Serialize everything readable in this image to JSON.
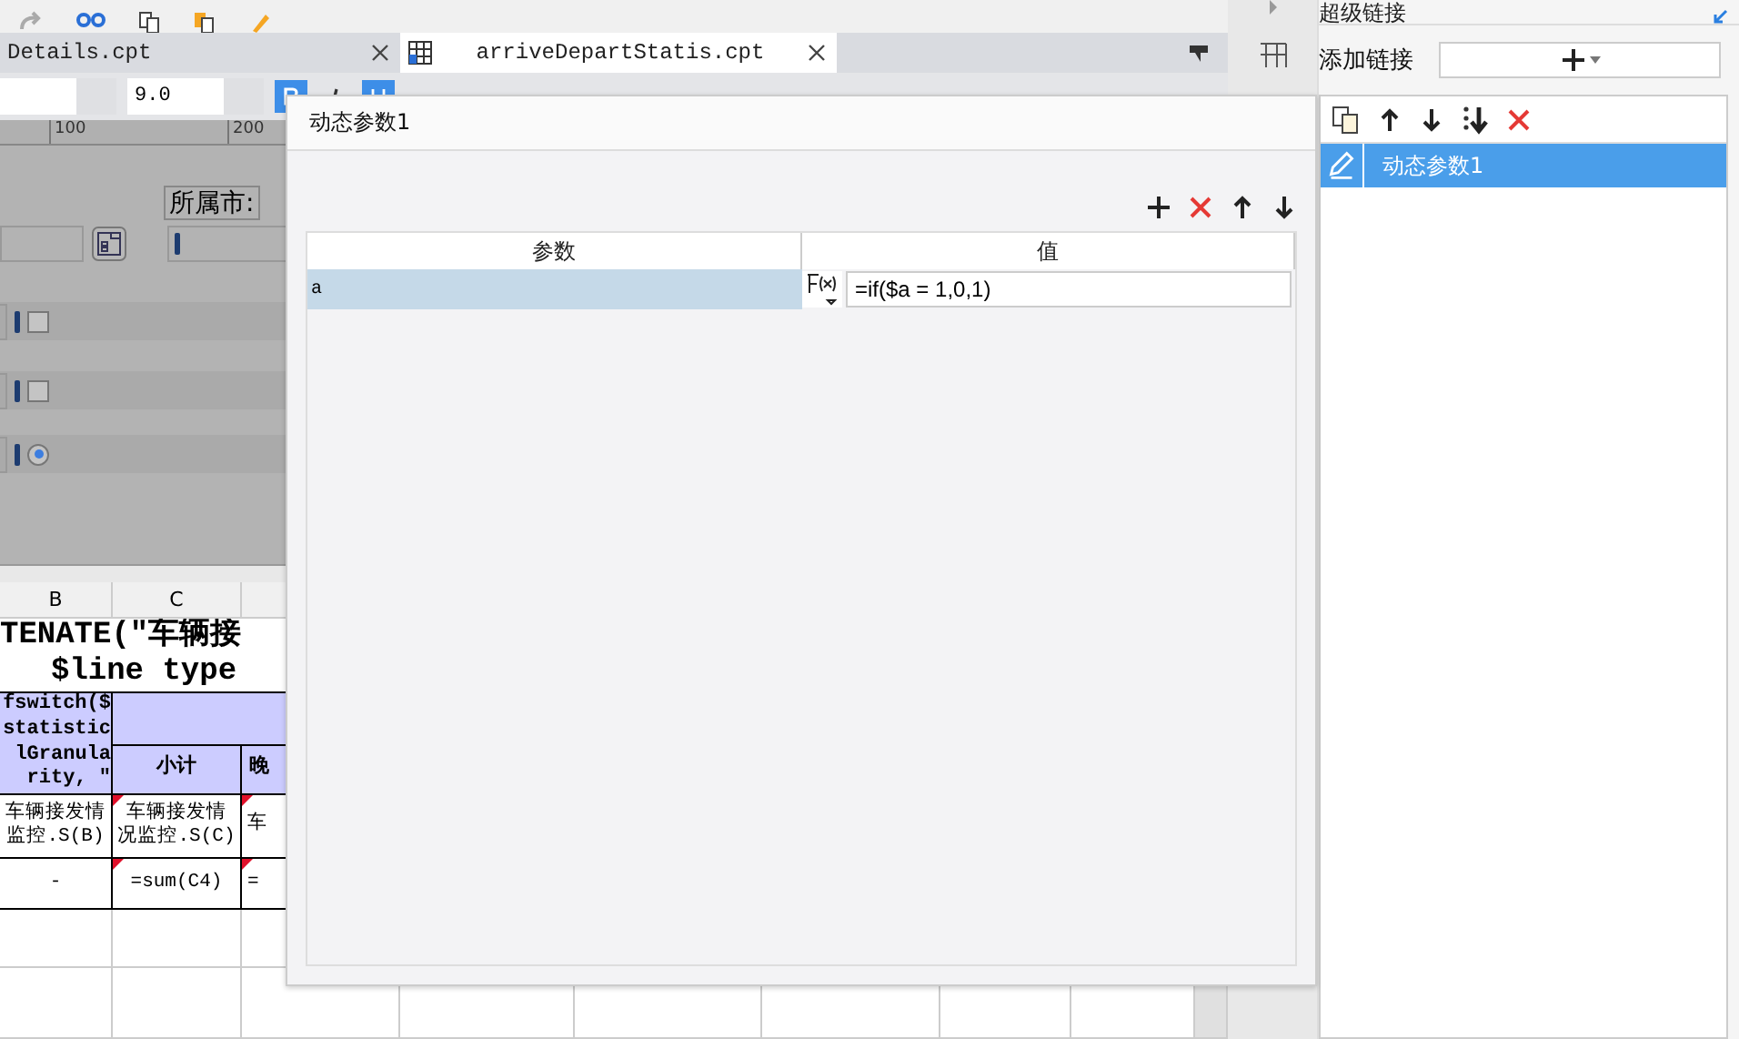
{
  "tabs": [
    {
      "label": "Details.cpt",
      "selected": false
    },
    {
      "label": "arriveDepartStatis.cpt",
      "selected": true
    }
  ],
  "format_toolbar": {
    "font_size": "9.0",
    "bold": true,
    "italic": false,
    "underline": true
  },
  "ruler": {
    "marks": [
      "100",
      "200"
    ]
  },
  "design": {
    "label": "所属市:",
    "rows": [
      {
        "kind": "checkbox",
        "checked": false
      },
      {
        "kind": "checkbox",
        "checked": false
      },
      {
        "kind": "radio",
        "checked": true
      }
    ]
  },
  "sheet": {
    "columns": [
      "B",
      "C"
    ],
    "title_lines": [
      "TENATE(\"车辆接",
      "$line type"
    ],
    "group_header": {
      "lines": [
        "fswitch($",
        "statistic",
        "lGranula",
        "rity, \""
      ]
    },
    "subheaders": [
      {
        "text": "小计"
      },
      {
        "text": "晚"
      }
    ],
    "data_rows": [
      {
        "cells": [
          {
            "lines": [
              "车辆接发情",
              "监控.S(B)"
            ],
            "marked": false
          },
          {
            "lines": [
              "车辆接发情",
              "况监控.S(C)"
            ],
            "marked": true
          },
          {
            "lines": [
              "车"
            ],
            "marked": true
          }
        ]
      },
      {
        "cells": [
          {
            "lines": [
              "-"
            ],
            "marked": false
          },
          {
            "lines": [
              "=sum(C4)"
            ],
            "marked": true
          },
          {
            "lines": [
              "="
            ],
            "marked": true
          }
        ]
      }
    ]
  },
  "dialog": {
    "title": "动态参数1",
    "columns": [
      "参数",
      "值"
    ],
    "rows": [
      {
        "name": "a",
        "value": "=if($a = 1,0,1)",
        "selected": true
      }
    ]
  },
  "side_panel": {
    "title": "超级链接",
    "add_label": "添加链接",
    "links": [
      {
        "label": "动态参数1",
        "selected": true
      }
    ]
  }
}
